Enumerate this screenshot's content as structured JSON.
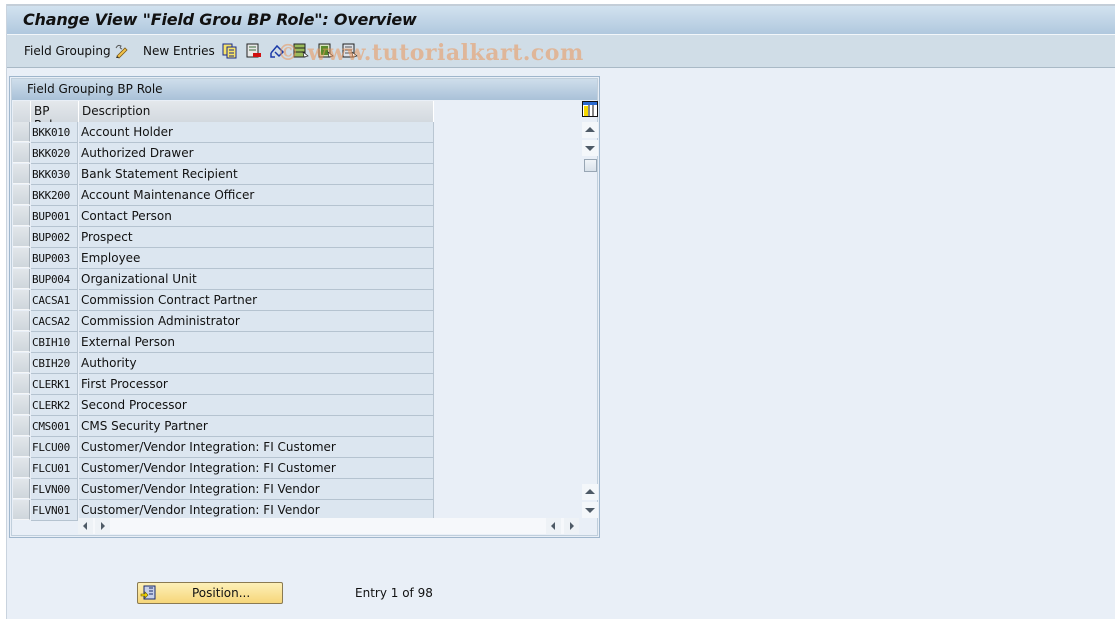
{
  "window": {
    "title": "Change View \"Field Grou BP Role\": Overview"
  },
  "toolbar": {
    "field_grouping_label": "Field Grouping",
    "new_entries_label": "New Entries",
    "icons": [
      "display-change-icon",
      "copy-as-icon",
      "delete-icon",
      "undo-change-icon",
      "select-all-icon",
      "select-block-icon",
      "deselect-all-icon"
    ],
    "watermark": "© www.tutorialkart.com"
  },
  "panel": {
    "title": "Field Grouping BP Role",
    "columns": [
      "BP Role",
      "Description"
    ],
    "rows": [
      {
        "role": "BKK010",
        "desc": "Account Holder"
      },
      {
        "role": "BKK020",
        "desc": "Authorized Drawer"
      },
      {
        "role": "BKK030",
        "desc": "Bank Statement Recipient"
      },
      {
        "role": "BKK200",
        "desc": "Account Maintenance Officer"
      },
      {
        "role": "BUP001",
        "desc": "Contact Person"
      },
      {
        "role": "BUP002",
        "desc": "Prospect"
      },
      {
        "role": "BUP003",
        "desc": "Employee"
      },
      {
        "role": "BUP004",
        "desc": "Organizational Unit"
      },
      {
        "role": "CACSA1",
        "desc": "Commission Contract Partner"
      },
      {
        "role": "CACSA2",
        "desc": "Commission Administrator"
      },
      {
        "role": "CBIH10",
        "desc": "External Person"
      },
      {
        "role": "CBIH20",
        "desc": "Authority"
      },
      {
        "role": "CLERK1",
        "desc": "First Processor"
      },
      {
        "role": "CLERK2",
        "desc": "Second Processor"
      },
      {
        "role": "CMS001",
        "desc": "CMS Security Partner"
      },
      {
        "role": "FLCU00",
        "desc": "Customer/Vendor Integration: FI Customer"
      },
      {
        "role": "FLCU01",
        "desc": "Customer/Vendor Integration: FI Customer"
      },
      {
        "role": "FLVN00",
        "desc": "Customer/Vendor Integration: FI Vendor"
      },
      {
        "role": "FLVN01",
        "desc": "Customer/Vendor Integration: FI Vendor"
      }
    ]
  },
  "footer": {
    "position_button": "Position...",
    "entry_text": "Entry 1 of 98"
  }
}
